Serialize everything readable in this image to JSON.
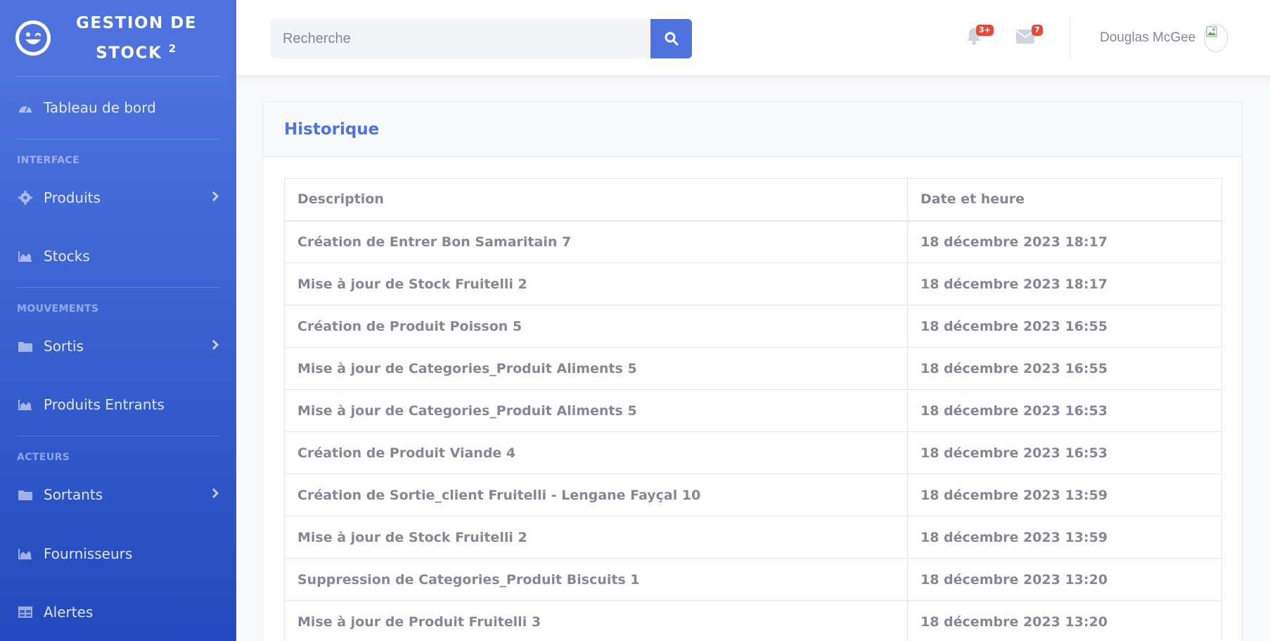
{
  "brand": {
    "title": "GESTION DE STOCK",
    "superscript": "2"
  },
  "sidebar": {
    "dashboard": "Tableau de bord",
    "heading_interface": "INTERFACE",
    "produits": "Produits",
    "stocks": "Stocks",
    "heading_mouvements": "MOUVEMENTS",
    "sortis": "Sortis",
    "produits_entrants": "Produits Entrants",
    "heading_acteurs": "ACTEURS",
    "sortants": "Sortants",
    "fournisseurs": "Fournisseurs",
    "alertes": "Alertes"
  },
  "search": {
    "placeholder": "Recherche"
  },
  "alerts": {
    "badge": "3+"
  },
  "messages": {
    "badge": "7"
  },
  "user": {
    "name": "Douglas McGee"
  },
  "card": {
    "title": "Historique"
  },
  "table": {
    "headers": [
      "Description",
      "Date et heure"
    ],
    "rows": [
      [
        "Création de Entrer Bon Samaritain 7",
        "18 décembre 2023 18:17"
      ],
      [
        "Mise à jour de Stock Fruitelli 2",
        "18 décembre 2023 18:17"
      ],
      [
        "Création de Produit Poisson 5",
        "18 décembre 2023 16:55"
      ],
      [
        "Mise à jour de Categories_Produit Aliments 5",
        "18 décembre 2023 16:55"
      ],
      [
        "Mise à jour de Categories_Produit Aliments 5",
        "18 décembre 2023 16:53"
      ],
      [
        "Création de Produit Viande 4",
        "18 décembre 2023 16:53"
      ],
      [
        "Création de Sortie_client Fruitelli - Lengane Fayçal 10",
        "18 décembre 2023 13:59"
      ],
      [
        "Mise à jour de Stock Fruitelli 2",
        "18 décembre 2023 13:59"
      ],
      [
        "Suppression de Categories_Produit Biscuits 1",
        "18 décembre 2023 13:20"
      ],
      [
        "Mise à jour de Produit Fruitelli 3",
        "18 décembre 2023 13:20"
      ]
    ]
  },
  "colors": {
    "primary": "#4e73df",
    "danger": "#e74a3b",
    "text": "#858796"
  }
}
